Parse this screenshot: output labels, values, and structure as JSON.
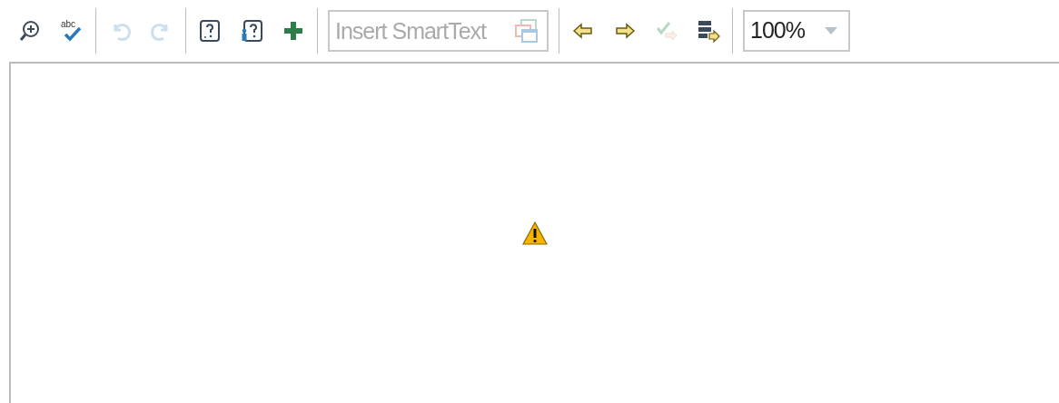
{
  "toolbar": {
    "groups": [
      {
        "buttons": [
          {
            "kind": "zoom-in",
            "disabled": false
          },
          {
            "kind": "spellcheck",
            "disabled": false,
            "label": "abc"
          }
        ]
      },
      {
        "buttons": [
          {
            "kind": "undo",
            "disabled": true
          },
          {
            "kind": "redo",
            "disabled": true
          }
        ]
      },
      {
        "buttons": [
          {
            "kind": "help",
            "disabled": false
          },
          {
            "kind": "user-help",
            "disabled": false
          },
          {
            "kind": "add",
            "disabled": false
          }
        ]
      }
    ],
    "smarttext": {
      "placeholder": "Insert SmartText"
    },
    "nav_buttons": [
      {
        "kind": "previous",
        "disabled": false
      },
      {
        "kind": "next",
        "disabled": false
      },
      {
        "kind": "accept",
        "disabled": true
      },
      {
        "kind": "list-next",
        "disabled": false
      }
    ],
    "zoom": {
      "value": "100%"
    }
  },
  "canvas": {
    "warning": true
  }
}
